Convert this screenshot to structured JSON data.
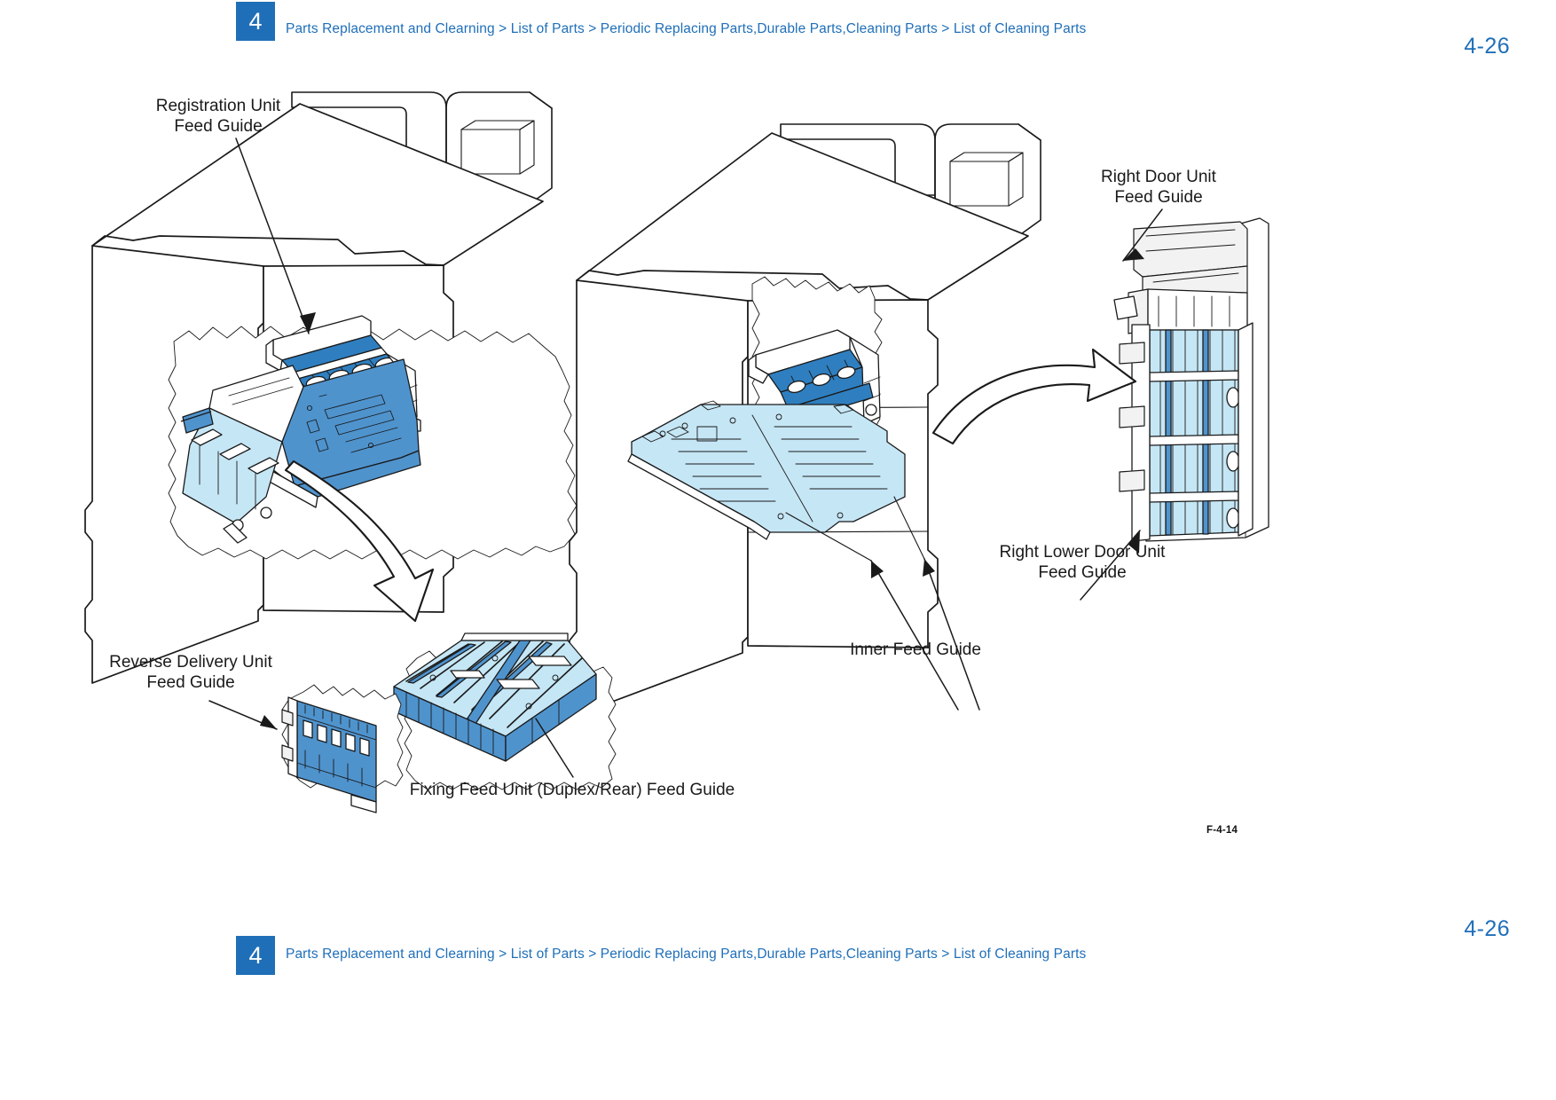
{
  "document": {
    "chapter_number": "4",
    "breadcrumb": "Parts Replacement and Clearning > List of Parts > Periodic Replacing Parts,Durable Parts,Cleaning Parts > List of Cleaning Parts",
    "page_number_top": "4-26",
    "page_number_bottom": "4-26",
    "figure_code": "F-4-14"
  },
  "callouts": {
    "registration": "Registration Unit\nFeed Guide",
    "right_door": "Right Door Unit\nFeed Guide",
    "right_lower_door": "Right Lower Door Unit\nFeed Guide",
    "inner": "Inner Feed Guide",
    "reverse_delivery": "Reverse Delivery Unit\nFeed Guide",
    "fixing_feed": "Fixing Feed Unit (Duplex/Rear) Feed Guide"
  },
  "colors": {
    "accent_blue": "#1f6fb8",
    "part_blue_medium": "#4f93cd",
    "part_blue_light": "#c5e6f5",
    "part_blue_dark": "#2f7fc0",
    "line_black": "#1a1a1a",
    "page_background": "#ffffff"
  }
}
